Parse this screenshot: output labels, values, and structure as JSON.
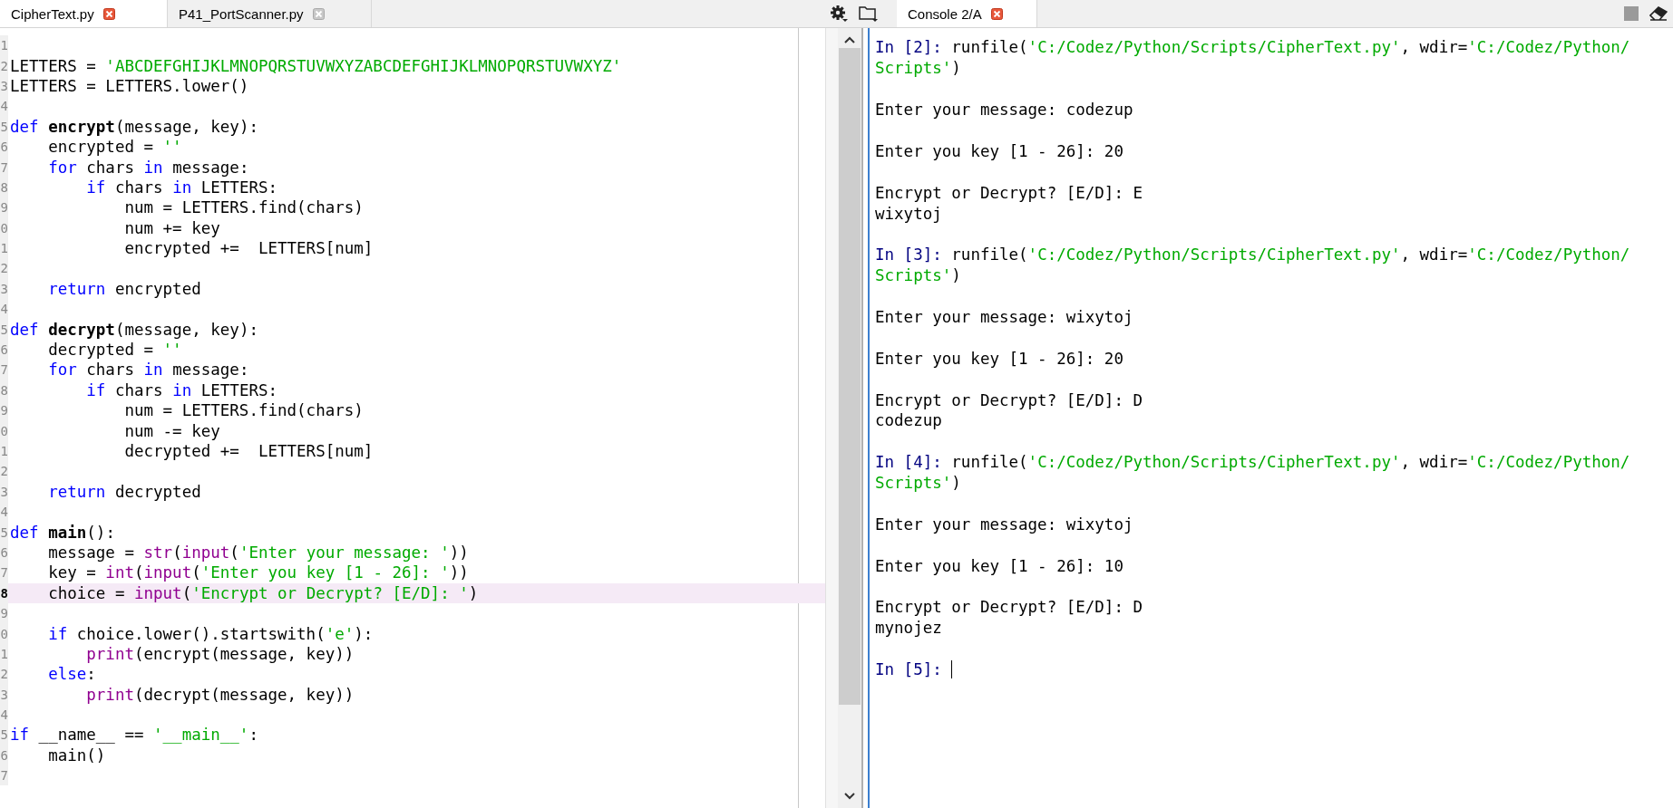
{
  "editor": {
    "tabs": [
      {
        "label": "CipherText.py",
        "selected": true
      },
      {
        "label": "P41_PortScanner.py",
        "selected": false
      }
    ],
    "lines": [
      {
        "number": "1",
        "current": false
      },
      {
        "number": "2",
        "current": false,
        "tokens": [
          {
            "kind": "plain",
            "text": "LETTERS = "
          },
          {
            "kind": "str",
            "text": "'ABCDEFGHIJKLMNOPQRSTUVWXYZABCDEFGHIJKLMNOPQRSTUVWXYZ'"
          }
        ]
      },
      {
        "number": "3",
        "current": false,
        "tokens": [
          {
            "kind": "plain",
            "text": "LETTERS = LETTERS.lower()"
          }
        ]
      },
      {
        "number": "4",
        "current": false
      },
      {
        "number": "5",
        "current": false,
        "tokens": [
          {
            "kind": "kw",
            "text": "def "
          },
          {
            "kind": "name",
            "text": "encrypt"
          },
          {
            "kind": "plain",
            "text": "(message, key):"
          }
        ]
      },
      {
        "number": "6",
        "current": false,
        "tokens": [
          {
            "kind": "plain",
            "text": "    encrypted = "
          },
          {
            "kind": "str",
            "text": "''"
          }
        ]
      },
      {
        "number": "7",
        "current": false,
        "tokens": [
          {
            "kind": "kw",
            "text": "    for"
          },
          {
            "kind": "plain",
            "text": " chars "
          },
          {
            "kind": "kw",
            "text": "in"
          },
          {
            "kind": "plain",
            "text": " message:"
          }
        ]
      },
      {
        "number": "8",
        "current": false,
        "tokens": [
          {
            "kind": "kw",
            "text": "        if"
          },
          {
            "kind": "plain",
            "text": " chars "
          },
          {
            "kind": "kw",
            "text": "in"
          },
          {
            "kind": "plain",
            "text": " LETTERS:"
          }
        ]
      },
      {
        "number": "9",
        "current": false,
        "tokens": [
          {
            "kind": "plain",
            "text": "            num = LETTERS.find(chars)"
          }
        ]
      },
      {
        "number": "0",
        "current": false,
        "tokens": [
          {
            "kind": "plain",
            "text": "            num += key"
          }
        ]
      },
      {
        "number": "1",
        "current": false,
        "tokens": [
          {
            "kind": "plain",
            "text": "            encrypted +=  LETTERS[num]"
          }
        ]
      },
      {
        "number": "2",
        "current": false
      },
      {
        "number": "3",
        "current": false,
        "tokens": [
          {
            "kind": "kw",
            "text": "    return"
          },
          {
            "kind": "plain",
            "text": " encrypted"
          }
        ]
      },
      {
        "number": "4",
        "current": false
      },
      {
        "number": "5",
        "current": false,
        "tokens": [
          {
            "kind": "kw",
            "text": "def "
          },
          {
            "kind": "name",
            "text": "decrypt"
          },
          {
            "kind": "plain",
            "text": "(message, key):"
          }
        ]
      },
      {
        "number": "6",
        "current": false,
        "tokens": [
          {
            "kind": "plain",
            "text": "    decrypted = "
          },
          {
            "kind": "str",
            "text": "''"
          }
        ]
      },
      {
        "number": "7",
        "current": false,
        "tokens": [
          {
            "kind": "kw",
            "text": "    for"
          },
          {
            "kind": "plain",
            "text": " chars "
          },
          {
            "kind": "kw",
            "text": "in"
          },
          {
            "kind": "plain",
            "text": " message:"
          }
        ]
      },
      {
        "number": "8",
        "current": false,
        "tokens": [
          {
            "kind": "kw",
            "text": "        if"
          },
          {
            "kind": "plain",
            "text": " chars "
          },
          {
            "kind": "kw",
            "text": "in"
          },
          {
            "kind": "plain",
            "text": " LETTERS:"
          }
        ]
      },
      {
        "number": "9",
        "current": false,
        "tokens": [
          {
            "kind": "plain",
            "text": "            num = LETTERS.find(chars)"
          }
        ]
      },
      {
        "number": "0",
        "current": false,
        "tokens": [
          {
            "kind": "plain",
            "text": "            num -= key"
          }
        ]
      },
      {
        "number": "1",
        "current": false,
        "tokens": [
          {
            "kind": "plain",
            "text": "            decrypted +=  LETTERS[num]"
          }
        ]
      },
      {
        "number": "2",
        "current": false
      },
      {
        "number": "3",
        "current": false,
        "tokens": [
          {
            "kind": "kw",
            "text": "    return"
          },
          {
            "kind": "plain",
            "text": " decrypted"
          }
        ]
      },
      {
        "number": "4",
        "current": false
      },
      {
        "number": "5",
        "current": false,
        "tokens": [
          {
            "kind": "kw",
            "text": "def "
          },
          {
            "kind": "name",
            "text": "main"
          },
          {
            "kind": "plain",
            "text": "():"
          }
        ]
      },
      {
        "number": "6",
        "current": false,
        "tokens": [
          {
            "kind": "plain",
            "text": "    message = "
          },
          {
            "kind": "builtin",
            "text": "str"
          },
          {
            "kind": "plain",
            "text": "("
          },
          {
            "kind": "builtin",
            "text": "input"
          },
          {
            "kind": "plain",
            "text": "("
          },
          {
            "kind": "str",
            "text": "'Enter your message: '"
          },
          {
            "kind": "plain",
            "text": "))"
          }
        ]
      },
      {
        "number": "7",
        "current": false,
        "tokens": [
          {
            "kind": "plain",
            "text": "    key = "
          },
          {
            "kind": "builtin",
            "text": "int"
          },
          {
            "kind": "plain",
            "text": "("
          },
          {
            "kind": "builtin",
            "text": "input"
          },
          {
            "kind": "plain",
            "text": "("
          },
          {
            "kind": "str",
            "text": "'Enter you key [1 - 26]: '"
          },
          {
            "kind": "plain",
            "text": "))"
          }
        ]
      },
      {
        "number": "8",
        "current": true,
        "tokens": [
          {
            "kind": "plain",
            "text": "    choice = "
          },
          {
            "kind": "builtin",
            "text": "input"
          },
          {
            "kind": "plain",
            "text": "("
          },
          {
            "kind": "str",
            "text": "'Encrypt or Decrypt? [E/D]: '"
          },
          {
            "kind": "plain",
            "text": ")"
          }
        ]
      },
      {
        "number": "9",
        "current": false
      },
      {
        "number": "0",
        "current": false,
        "tokens": [
          {
            "kind": "kw",
            "text": "    if"
          },
          {
            "kind": "plain",
            "text": " choice.lower().startswith("
          },
          {
            "kind": "str",
            "text": "'e'"
          },
          {
            "kind": "plain",
            "text": "):"
          }
        ]
      },
      {
        "number": "1",
        "current": false,
        "tokens": [
          {
            "kind": "builtin",
            "text": "        print"
          },
          {
            "kind": "plain",
            "text": "(encrypt(message, key))"
          }
        ]
      },
      {
        "number": "2",
        "current": false,
        "tokens": [
          {
            "kind": "kw",
            "text": "    else"
          },
          {
            "kind": "plain",
            "text": ":"
          }
        ]
      },
      {
        "number": "3",
        "current": false,
        "tokens": [
          {
            "kind": "builtin",
            "text": "        print"
          },
          {
            "kind": "plain",
            "text": "(decrypt(message, key))"
          }
        ]
      },
      {
        "number": "4",
        "current": false
      },
      {
        "number": "5",
        "current": false,
        "tokens": [
          {
            "kind": "kw",
            "text": "if"
          },
          {
            "kind": "plain",
            "text": " __name__ == "
          },
          {
            "kind": "str",
            "text": "'__main__'"
          },
          {
            "kind": "plain",
            "text": ":"
          }
        ]
      },
      {
        "number": "6",
        "current": false,
        "tokens": [
          {
            "kind": "plain",
            "text": "    main()"
          }
        ]
      },
      {
        "number": "7",
        "current": false
      }
    ]
  },
  "console": {
    "tab": {
      "label": "Console 2/A",
      "selected": true
    },
    "lines": [
      {
        "kind": "in",
        "prompt": "In [2]:",
        "tokens": [
          {
            "kind": "plain",
            "text": "runfile("
          },
          {
            "kind": "str",
            "text": "'C:/Codez/Python/Scripts/CipherText.py'"
          },
          {
            "kind": "plain",
            "text": ", wdir="
          },
          {
            "kind": "str",
            "text": "'C:/Codez/Python/"
          }
        ]
      },
      {
        "kind": "cont",
        "tokens": [
          {
            "kind": "str",
            "text": "Scripts'"
          },
          {
            "kind": "plain",
            "text": ")"
          }
        ]
      },
      {
        "kind": "blank"
      },
      {
        "kind": "out",
        "text": "Enter your message: codezup"
      },
      {
        "kind": "blank"
      },
      {
        "kind": "out",
        "text": "Enter you key [1 - 26]: 20"
      },
      {
        "kind": "blank"
      },
      {
        "kind": "out",
        "text": "Encrypt or Decrypt? [E/D]: E"
      },
      {
        "kind": "out",
        "text": "wixytoj"
      },
      {
        "kind": "blank"
      },
      {
        "kind": "in",
        "prompt": "In [3]:",
        "tokens": [
          {
            "kind": "plain",
            "text": "runfile("
          },
          {
            "kind": "str",
            "text": "'C:/Codez/Python/Scripts/CipherText.py'"
          },
          {
            "kind": "plain",
            "text": ", wdir="
          },
          {
            "kind": "str",
            "text": "'C:/Codez/Python/"
          }
        ]
      },
      {
        "kind": "cont",
        "tokens": [
          {
            "kind": "str",
            "text": "Scripts'"
          },
          {
            "kind": "plain",
            "text": ")"
          }
        ]
      },
      {
        "kind": "blank"
      },
      {
        "kind": "out",
        "text": "Enter your message: wixytoj"
      },
      {
        "kind": "blank"
      },
      {
        "kind": "out",
        "text": "Enter you key [1 - 26]: 20"
      },
      {
        "kind": "blank"
      },
      {
        "kind": "out",
        "text": "Encrypt or Decrypt? [E/D]: D"
      },
      {
        "kind": "out",
        "text": "codezup"
      },
      {
        "kind": "blank"
      },
      {
        "kind": "in",
        "prompt": "In [4]:",
        "tokens": [
          {
            "kind": "plain",
            "text": "runfile("
          },
          {
            "kind": "str",
            "text": "'C:/Codez/Python/Scripts/CipherText.py'"
          },
          {
            "kind": "plain",
            "text": ", wdir="
          },
          {
            "kind": "str",
            "text": "'C:/Codez/Python/"
          }
        ]
      },
      {
        "kind": "cont",
        "tokens": [
          {
            "kind": "str",
            "text": "Scripts'"
          },
          {
            "kind": "plain",
            "text": ")"
          }
        ]
      },
      {
        "kind": "blank"
      },
      {
        "kind": "out",
        "text": "Enter your message: wixytoj"
      },
      {
        "kind": "blank"
      },
      {
        "kind": "out",
        "text": "Enter you key [1 - 26]: 10"
      },
      {
        "kind": "blank"
      },
      {
        "kind": "out",
        "text": "Encrypt or Decrypt? [E/D]: D"
      },
      {
        "kind": "out",
        "text": "mynojez"
      },
      {
        "kind": "blank"
      },
      {
        "kind": "prompt",
        "prompt": "In [5]:"
      }
    ]
  }
}
